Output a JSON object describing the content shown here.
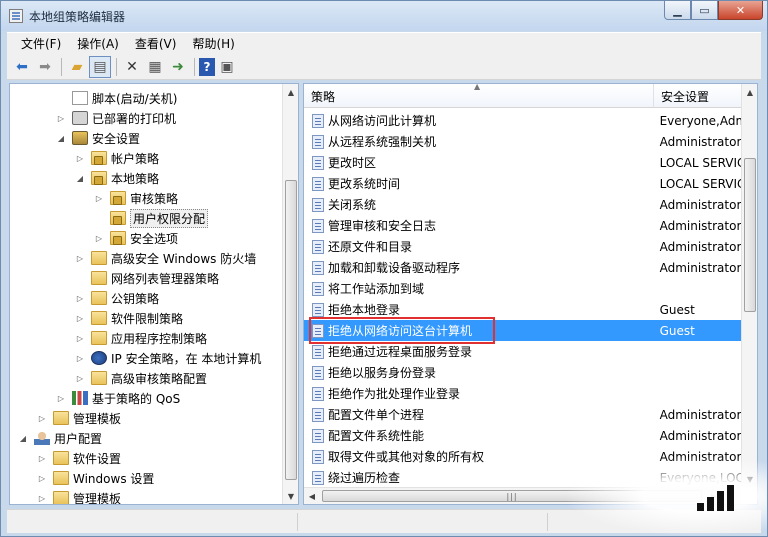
{
  "window": {
    "title": "本地组策略编辑器"
  },
  "menu": [
    "文件(F)",
    "操作(A)",
    "查看(V)",
    "帮助(H)"
  ],
  "tree": [
    {
      "label": "脚本(启动/关机)",
      "indent": 3,
      "icon": "script-icon",
      "expander": ""
    },
    {
      "label": "已部署的打印机",
      "indent": 3,
      "icon": "printer-icon",
      "expander": "closed"
    },
    {
      "label": "安全设置",
      "indent": 3,
      "icon": "security-icon",
      "expander": "open"
    },
    {
      "label": "帐户策略",
      "indent": 4,
      "icon": "folder-lock-icon",
      "expander": "closed"
    },
    {
      "label": "本地策略",
      "indent": 4,
      "icon": "folder-lock-icon",
      "expander": "open"
    },
    {
      "label": "审核策略",
      "indent": 5,
      "icon": "folder-lock-icon",
      "expander": "closed"
    },
    {
      "label": "用户权限分配",
      "indent": 5,
      "icon": "folder-lock-icon",
      "expander": "",
      "selected": true
    },
    {
      "label": "安全选项",
      "indent": 5,
      "icon": "folder-lock-icon",
      "expander": "closed"
    },
    {
      "label": "高级安全 Windows 防火墙",
      "indent": 4,
      "icon": "folder-icon",
      "expander": "closed"
    },
    {
      "label": "网络列表管理器策略",
      "indent": 4,
      "icon": "folder-icon",
      "expander": ""
    },
    {
      "label": "公钥策略",
      "indent": 4,
      "icon": "folder-icon",
      "expander": "closed"
    },
    {
      "label": "软件限制策略",
      "indent": 4,
      "icon": "folder-icon",
      "expander": "closed"
    },
    {
      "label": "应用程序控制策略",
      "indent": 4,
      "icon": "folder-icon",
      "expander": "closed"
    },
    {
      "label": "IP 安全策略，在 本地计算机",
      "indent": 4,
      "icon": "ipsec-icon",
      "expander": "closed"
    },
    {
      "label": "高级审核策略配置",
      "indent": 4,
      "icon": "folder-icon",
      "expander": "closed"
    },
    {
      "label": "基于策略的 QoS",
      "indent": 3,
      "icon": "qos-icon",
      "expander": "closed"
    },
    {
      "label": "管理模板",
      "indent": 2,
      "icon": "folder-icon",
      "expander": "closed"
    },
    {
      "label": "用户配置",
      "indent": 1,
      "icon": "user-icon",
      "expander": "open"
    },
    {
      "label": "软件设置",
      "indent": 2,
      "icon": "folder-icon",
      "expander": "closed"
    },
    {
      "label": "Windows 设置",
      "indent": 2,
      "icon": "folder-icon",
      "expander": "closed"
    },
    {
      "label": "管理模板",
      "indent": 2,
      "icon": "folder-icon",
      "expander": "closed"
    }
  ],
  "list": {
    "columns": [
      "策略",
      "安全设置"
    ],
    "rows": [
      {
        "name": "从网络访问此计算机",
        "setting": "Everyone,Adm"
      },
      {
        "name": "从远程系统强制关机",
        "setting": "Administrators"
      },
      {
        "name": "更改时区",
        "setting": "LOCAL SERVIC"
      },
      {
        "name": "更改系统时间",
        "setting": "LOCAL SERVIC"
      },
      {
        "name": "关闭系统",
        "setting": "Administrators"
      },
      {
        "name": "管理审核和安全日志",
        "setting": "Administrators"
      },
      {
        "name": "还原文件和目录",
        "setting": "Administrators"
      },
      {
        "name": "加载和卸载设备驱动程序",
        "setting": "Administrators"
      },
      {
        "name": "将工作站添加到域",
        "setting": ""
      },
      {
        "name": "拒绝本地登录",
        "setting": "Guest"
      },
      {
        "name": "拒绝从网络访问这台计算机",
        "setting": "Guest",
        "selected": true
      },
      {
        "name": "拒绝通过远程桌面服务登录",
        "setting": ""
      },
      {
        "name": "拒绝以服务身份登录",
        "setting": ""
      },
      {
        "name": "拒绝作为批处理作业登录",
        "setting": ""
      },
      {
        "name": "配置文件单个进程",
        "setting": "Administrators"
      },
      {
        "name": "配置文件系统性能",
        "setting": "Administrators"
      },
      {
        "name": "取得文件或其他对象的所有权",
        "setting": "Administrators"
      },
      {
        "name": "绕过遍历检查",
        "setting": "Everyone,LOC"
      }
    ]
  }
}
